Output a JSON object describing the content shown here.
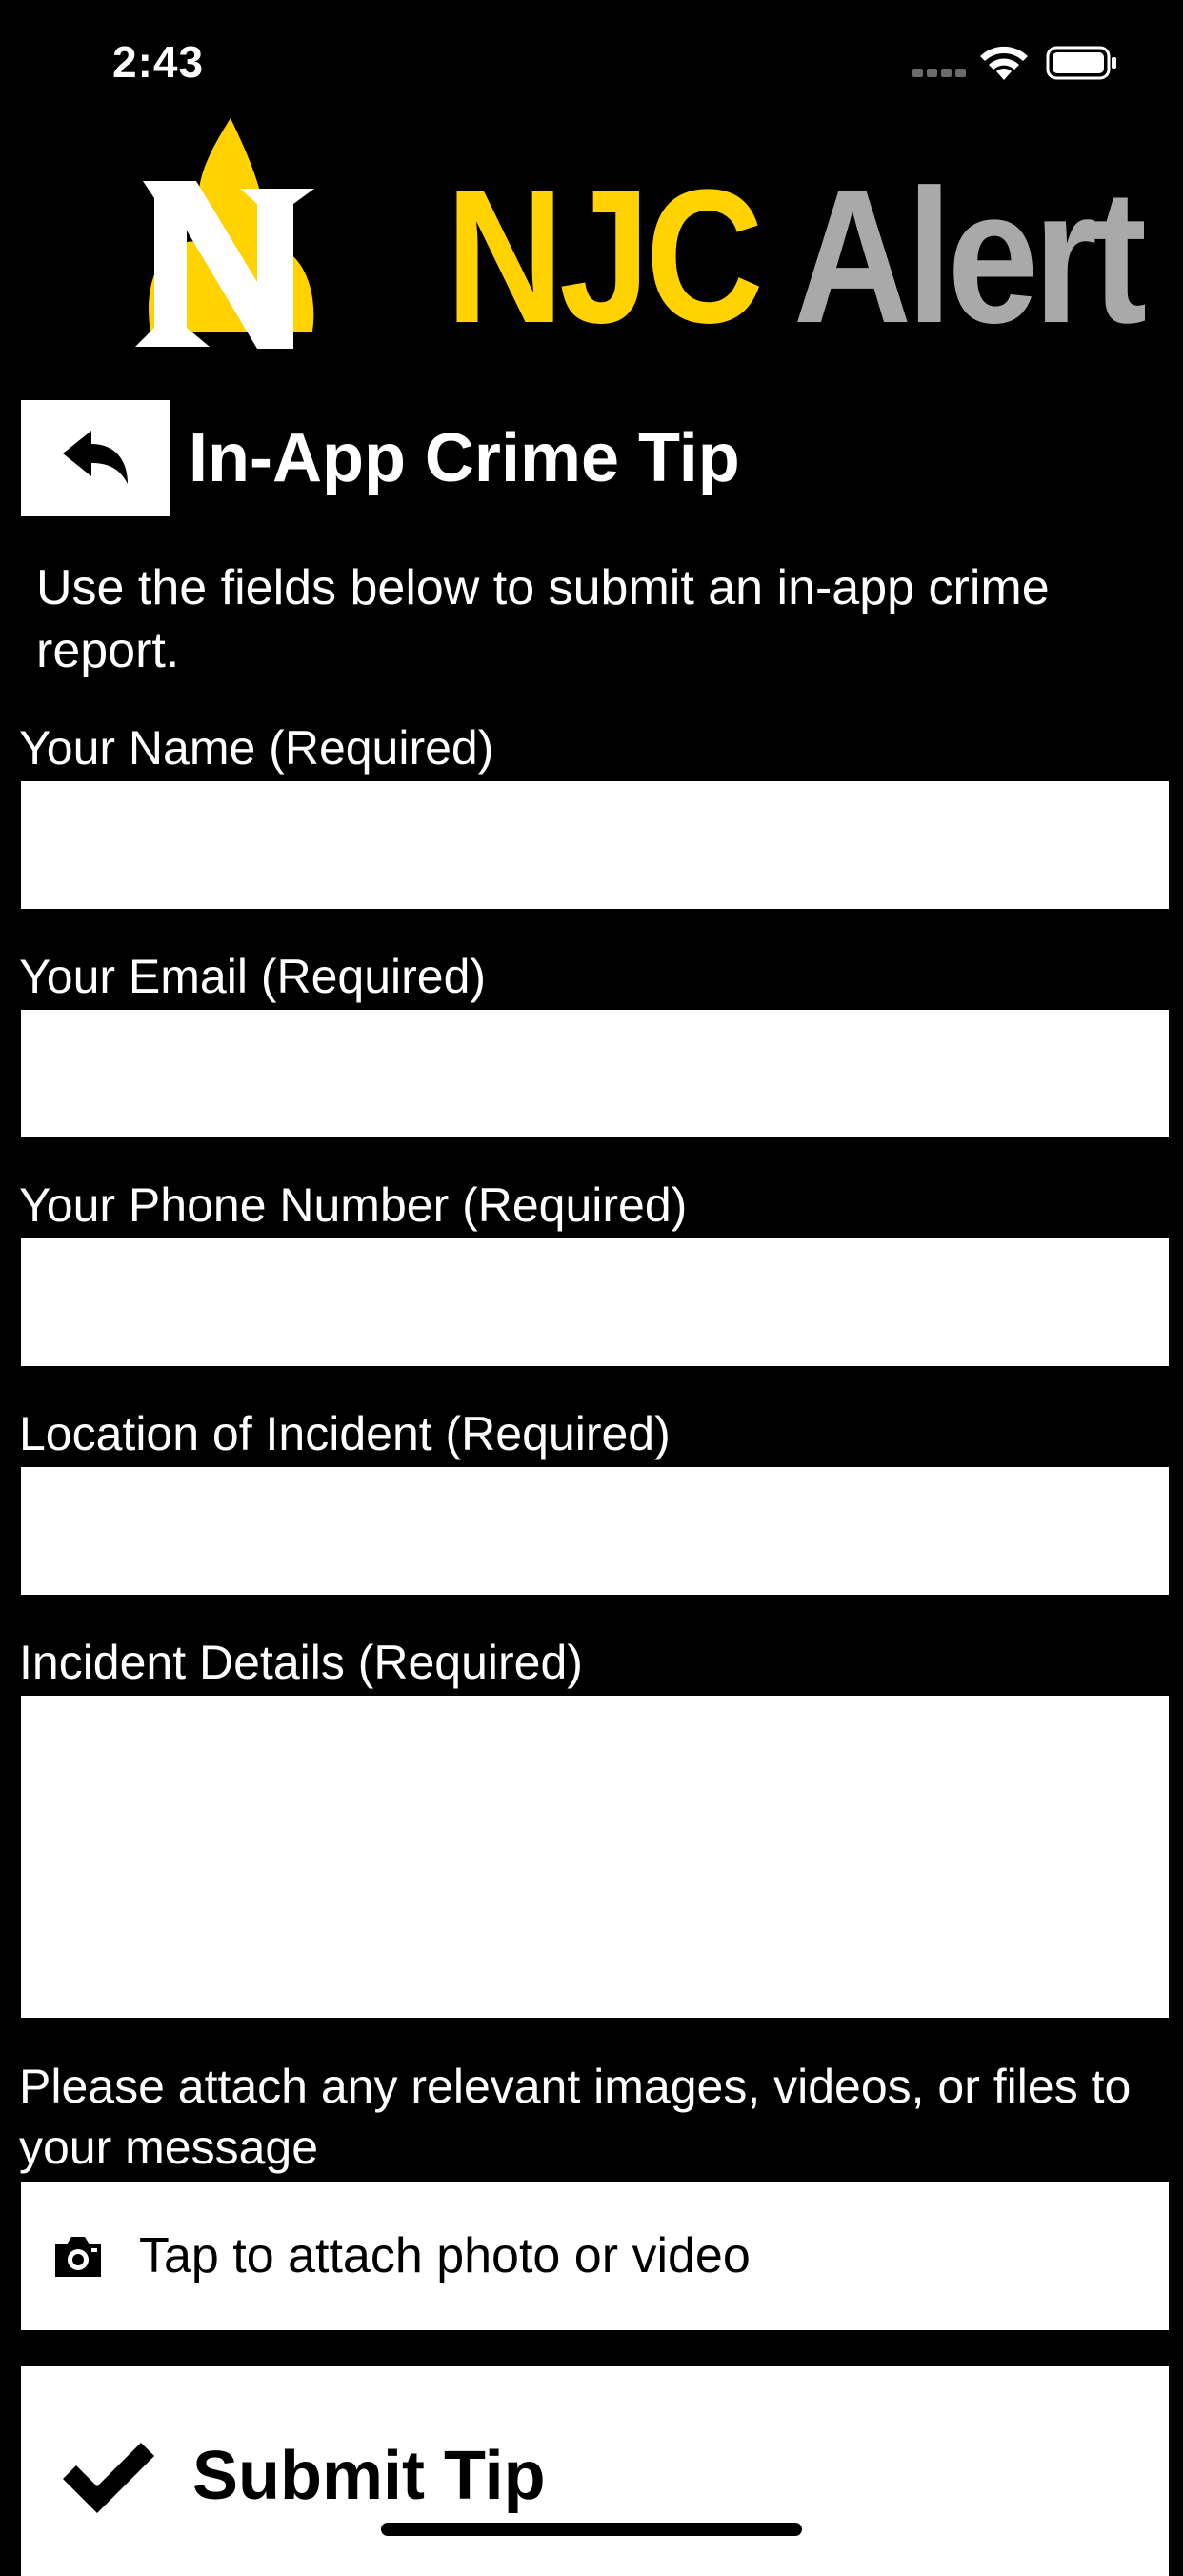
{
  "status_bar": {
    "time": "2:43",
    "icons": [
      "signal-icon",
      "wifi-icon",
      "battery-icon"
    ]
  },
  "header": {
    "logo_text_njc": "NJC",
    "logo_text_alert": "Alert",
    "brand_colors": {
      "yellow": "#ffd200",
      "gray": "#a9a9a9"
    }
  },
  "title_row": {
    "back_icon": "back-arrow-icon",
    "title": "In-App Crime Tip"
  },
  "intro": "Use the fields below to submit an in-app crime report.",
  "form": {
    "name_label": "Your Name (Required)",
    "name_value": "",
    "email_label": "Your Email (Required)",
    "email_value": "",
    "phone_label": "Your Phone Number (Required)",
    "phone_value": "",
    "location_label": "Location of Incident (Required)",
    "location_value": "",
    "details_label": "Incident Details (Required)",
    "details_value": ""
  },
  "attachments": {
    "label": "Please attach any relevant images, videos, or files to your message",
    "button_label": "Tap to attach photo or video",
    "icon": "camera-icon"
  },
  "submit": {
    "label": "Submit Tip",
    "icon": "checkmark-icon"
  }
}
